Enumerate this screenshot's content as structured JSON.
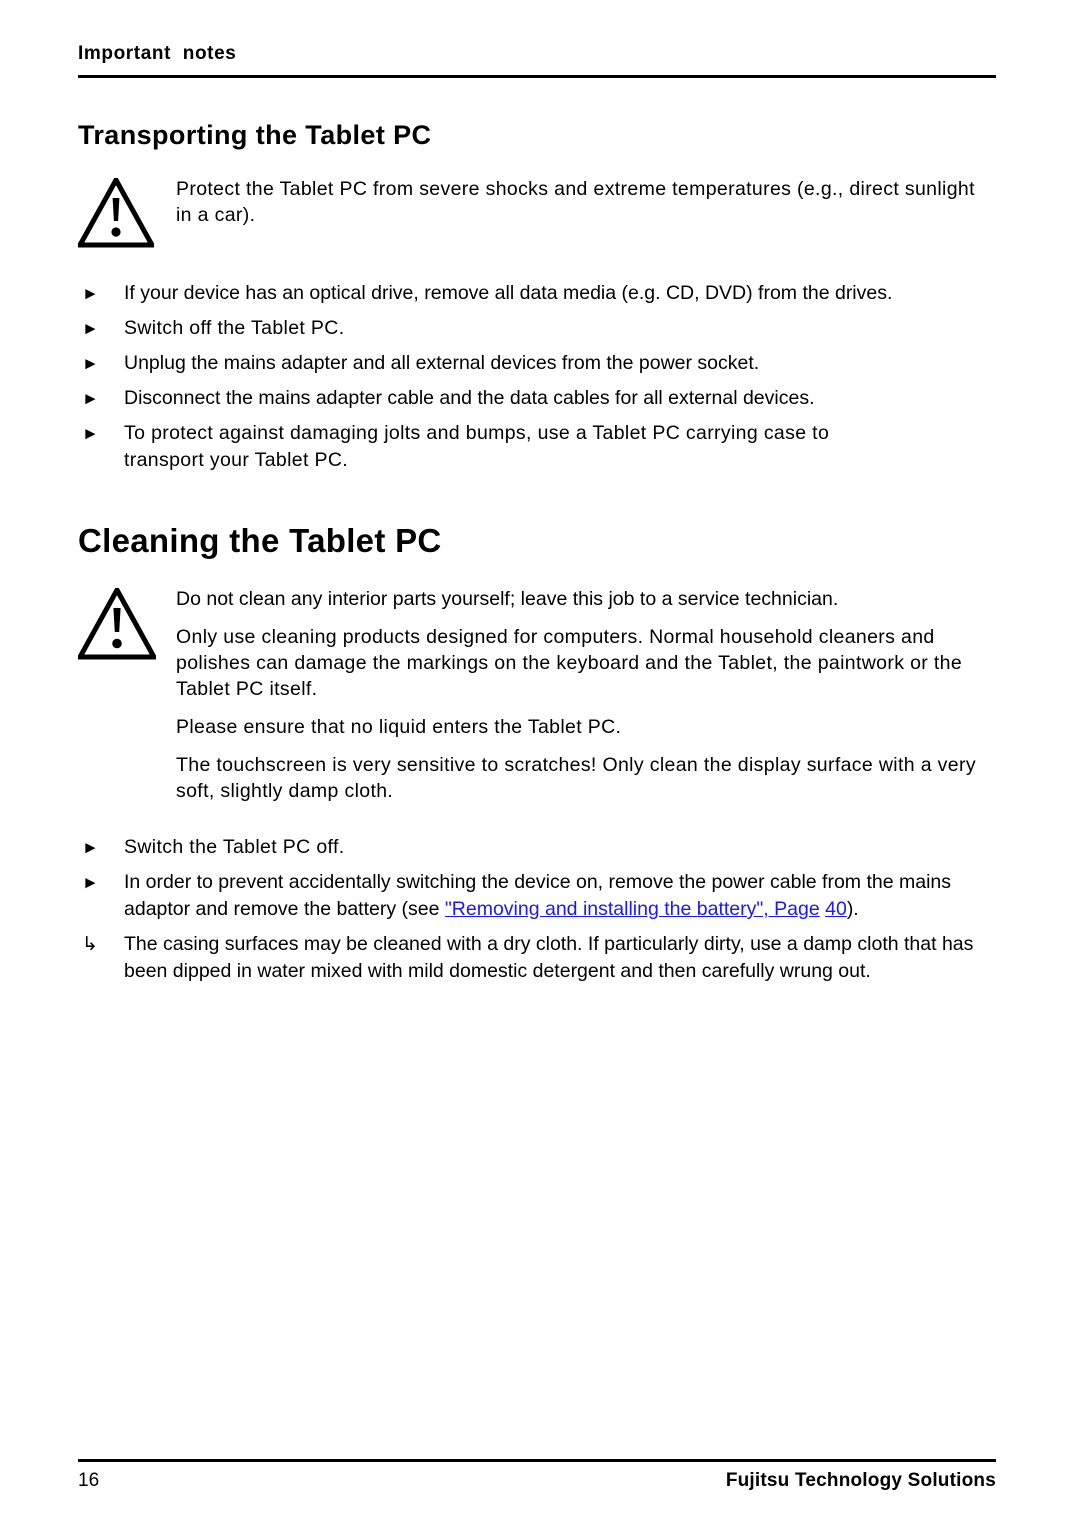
{
  "header": {
    "title": "Important  notes"
  },
  "sections": [
    {
      "id": "transporting",
      "title": "Transporting the Tablet PC",
      "note": {
        "icon": "warning-triangle-icon",
        "paragraphs": [
          "Protect the Tablet PC from severe shocks and extreme temperatures (e.g., direct sunlight in a car)."
        ]
      },
      "steps": [
        {
          "bullet": "►",
          "text": "If your device has an optical drive, remove all data media (e.g. CD, DVD) from the drives."
        },
        {
          "bullet": "►",
          "text": "Switch off the Tablet PC."
        },
        {
          "bullet": "►",
          "text": "Unplug the mains adapter and all external devices from the power socket."
        },
        {
          "bullet": "►",
          "text": "Disconnect the mains adapter cable and the data cables for all external devices."
        },
        {
          "bullet": "►",
          "text": "To protect against damaging jolts and bumps, use a Tablet PC carrying case to transport your Tablet PC."
        }
      ]
    },
    {
      "id": "cleaning",
      "title": "Cleaning the Tablet PC",
      "note": {
        "icon": "warning-triangle-icon",
        "paragraphs": [
          "Do not clean any interior parts yourself; leave this job to a service technician.",
          "Only use cleaning products designed for computers. Normal household cleaners and polishes can damage the markings on the keyboard and the Tablet, the paintwork or the Tablet PC itself.",
          "Please ensure that no liquid enters the Tablet PC.",
          "The touchscreen is very sensitive to scratches! Only clean the display surface with a very soft, slightly damp cloth."
        ]
      },
      "steps": [
        {
          "bullet": "►",
          "text": "Switch the Tablet PC off."
        },
        {
          "bullet": "►",
          "text_before": "In order to prevent accidentally switching the device on, remove the power cable from the mains adaptor and remove the battery (see ",
          "link_text": "\"Removing and installing the battery\", Page",
          "link_page": "40",
          "text_after": ")."
        },
        {
          "bullet": "↳",
          "text": "The casing surfaces may be cleaned with a dry cloth. If particularly dirty, use a damp cloth that has been dipped in water mixed with mild domestic detergent and then carefully wrung out."
        }
      ]
    }
  ],
  "footer": {
    "page_number": "16",
    "brand": "Fujitsu Technology Solutions"
  },
  "colors": {
    "text": "#000000",
    "link": "#1a1aee",
    "rule": "#000000",
    "background": "#ffffff"
  }
}
